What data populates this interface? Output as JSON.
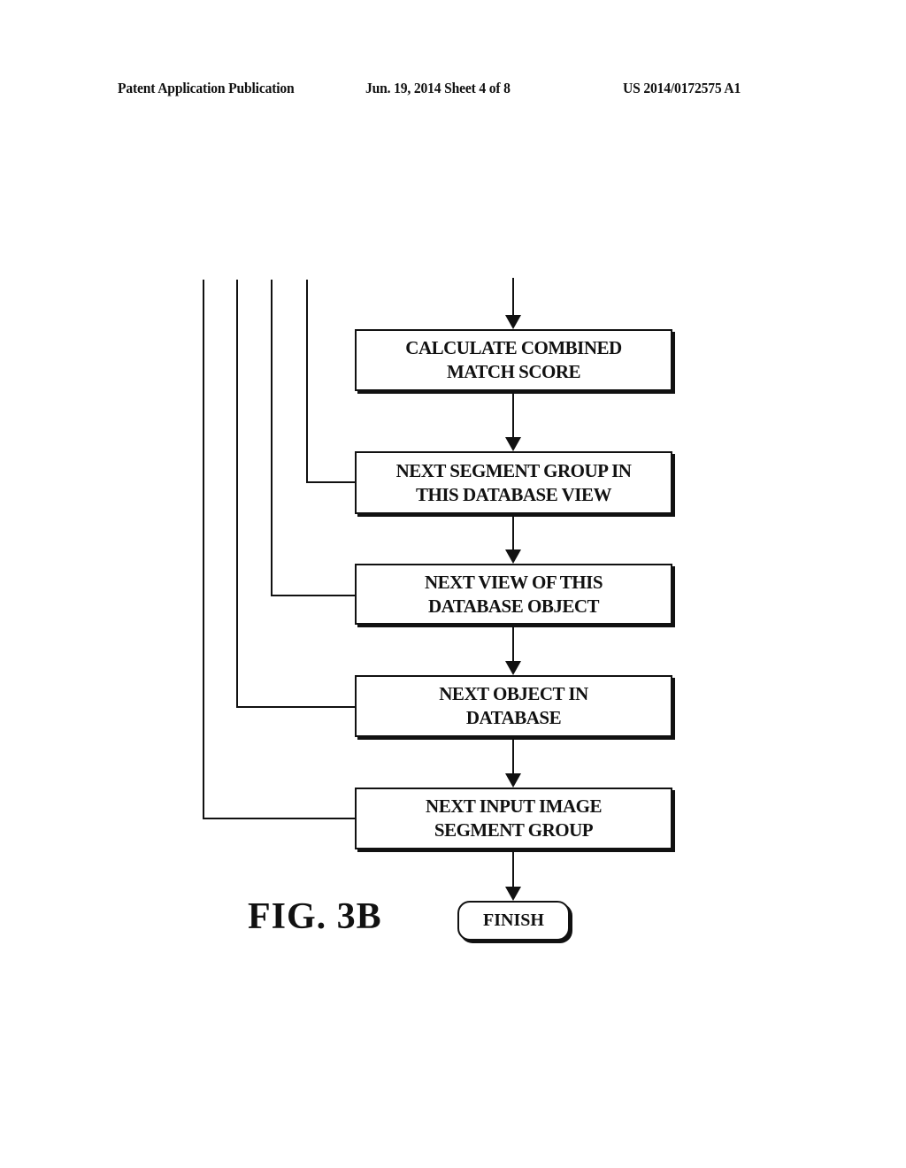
{
  "header": {
    "publication_type": "Patent Application Publication",
    "date_sheet": "Jun. 19, 2014  Sheet 4 of 8",
    "patent_number": "US 2014/0172575 A1"
  },
  "flowchart": {
    "steps": [
      {
        "line1": "CALCULATE COMBINED",
        "line2": "MATCH SCORE"
      },
      {
        "line1": "NEXT SEGMENT GROUP IN",
        "line2": "THIS DATABASE VIEW"
      },
      {
        "line1": "NEXT VIEW OF THIS",
        "line2": "DATABASE OBJECT"
      },
      {
        "line1": "NEXT OBJECT IN",
        "line2": "DATABASE"
      },
      {
        "line1": "NEXT INPUT IMAGE",
        "line2": "SEGMENT GROUP"
      }
    ],
    "terminal": "FINISH"
  },
  "figure_label": "FIG. 3B"
}
